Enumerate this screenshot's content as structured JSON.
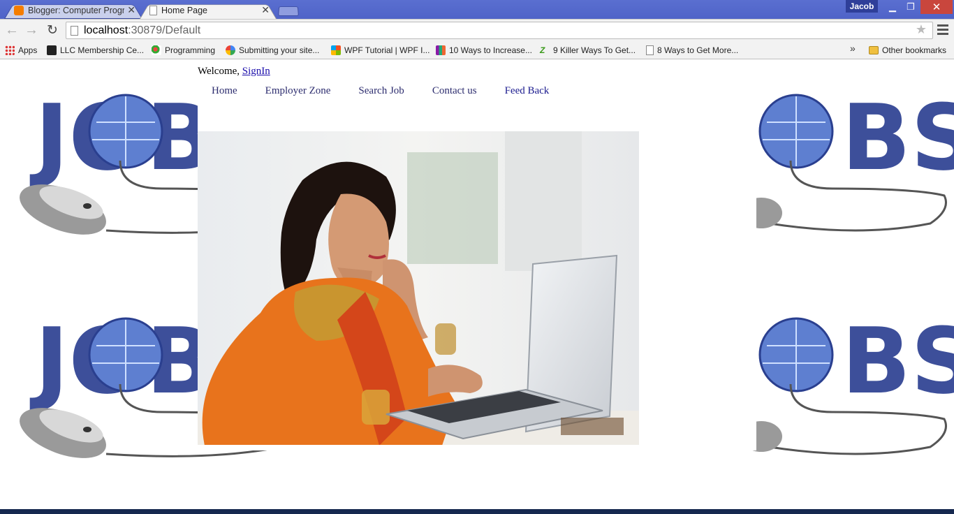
{
  "browser": {
    "tabs": [
      {
        "title": "Blogger: Computer Progra",
        "icon": "blogger-icon",
        "active": false
      },
      {
        "title": "Home Page",
        "icon": "page-icon",
        "active": true
      }
    ],
    "user": "Jacob",
    "url_host": "localhost",
    "url_path": ":30879/Default",
    "bookmarks": [
      {
        "label": "Apps",
        "icon": "apps-grid-icon"
      },
      {
        "label": "LLC Membership Ce...",
        "icon": "llc-icon"
      },
      {
        "label": "Programming",
        "icon": "programming-icon"
      },
      {
        "label": "Submitting your site...",
        "icon": "google-icon"
      },
      {
        "label": "WPF Tutorial | WPF I...",
        "icon": "windows-icon"
      },
      {
        "label": "10 Ways to Increase...",
        "icon": "grid-icon"
      },
      {
        "label": "9 Killer Ways To Get...",
        "icon": "ze-icon"
      },
      {
        "label": "8 Ways to Get More...",
        "icon": "page-icon"
      }
    ],
    "bookmarks_more": "»",
    "other_bookmarks": "Other bookmarks"
  },
  "page": {
    "welcome_text": "Welcome,",
    "signin_label": "SignIn",
    "nav": [
      "Home",
      "Employer Zone",
      "Search Job",
      "Contact us",
      "Feed Back"
    ],
    "background_logo_text": "JOBS"
  },
  "colors": {
    "titlebar": "#4f63c8",
    "link": "#1a0dab",
    "nav_text": "#2c2c6e",
    "logo_blue": "#3d4f9a",
    "saree_orange": "#e8731c"
  }
}
